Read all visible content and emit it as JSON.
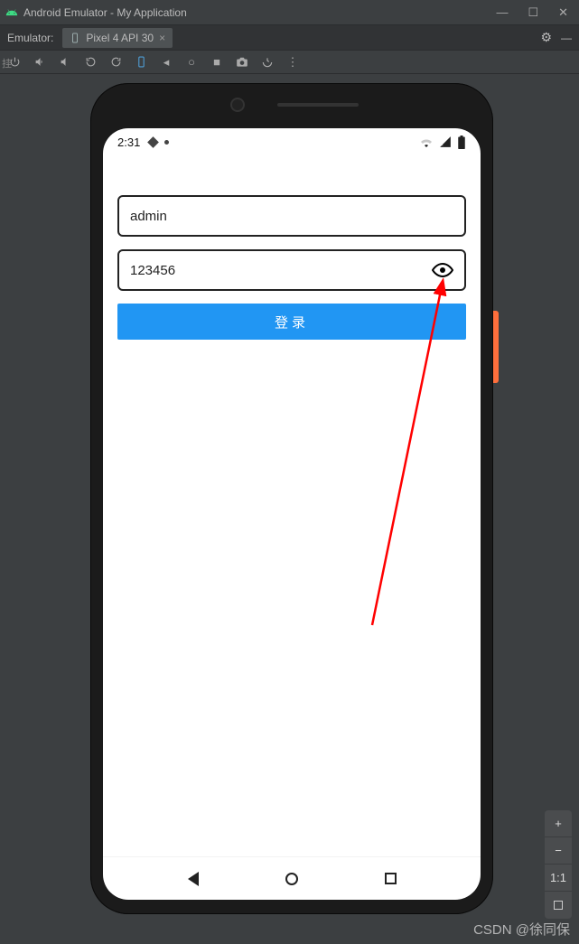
{
  "window": {
    "title": "Android Emulator - My Application"
  },
  "emulator_toolbar": {
    "label": "Emulator:",
    "tab_icon": "device-icon",
    "tab_label": "Pixel 4 API 30"
  },
  "statusbar": {
    "time": "2:31"
  },
  "form": {
    "username_value": "admin",
    "password_value": "123456",
    "login_label": "登录"
  },
  "side_panel": {
    "plus": "+",
    "minus": "−",
    "fit": "1:1"
  },
  "watermark": "CSDN @徐同保",
  "left_edge_text": "挂"
}
